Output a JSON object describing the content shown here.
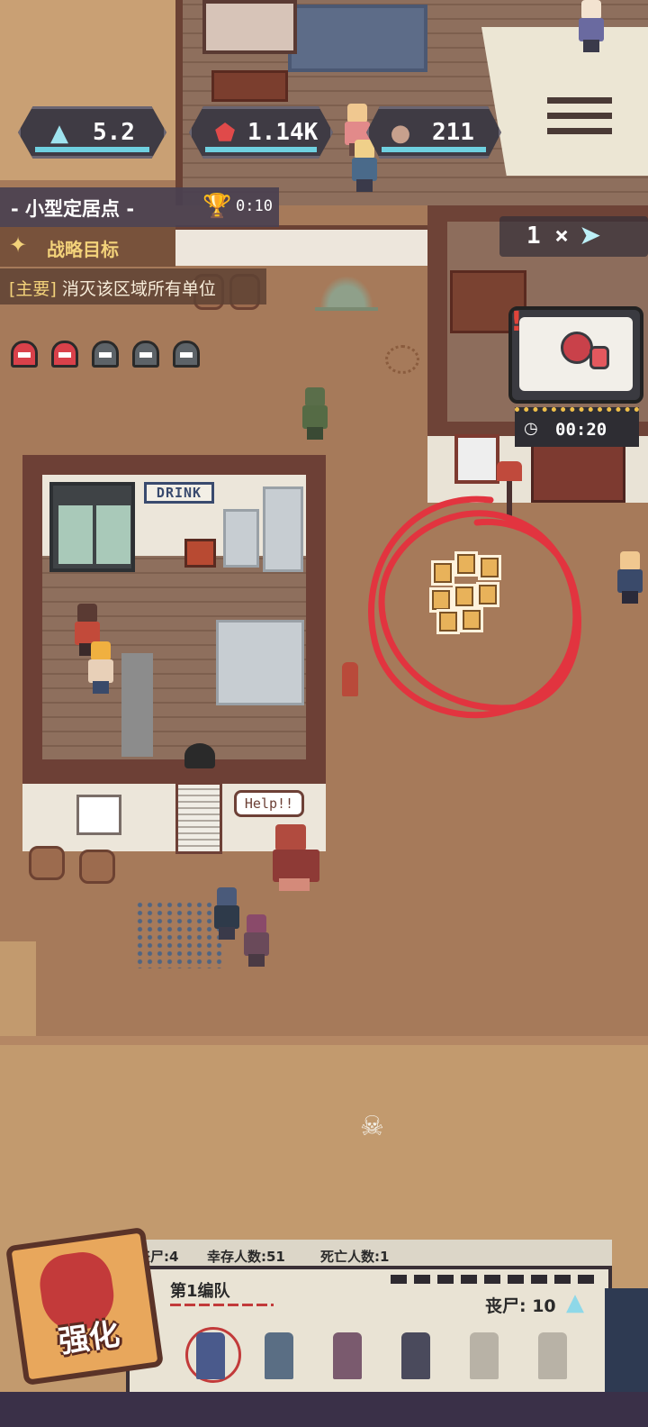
{
  "hud": {
    "resources": {
      "crystal": {
        "value": "5.2",
        "icon": "crystal-icon"
      },
      "gear": {
        "value": "1.14K",
        "icon": "gear-icon"
      },
      "stone": {
        "value": "211",
        "icon": "stone-icon"
      }
    },
    "level": {
      "name": "- 小型定居点 -",
      "timer": "0:10",
      "icon": "trophy-icon"
    },
    "objective": {
      "title": "战略目标",
      "tag": "[主要]",
      "text": "消灭该区域所有单位"
    },
    "waves": {
      "total": 5,
      "completed": 2
    },
    "speed": {
      "label": "1 ×",
      "icon": "fast-forward-icon"
    },
    "event": {
      "timer": "00:20",
      "icon": "potion-icon"
    }
  },
  "world": {
    "drink_sign": "DRINK",
    "help_bubble": "Help!!"
  },
  "squad_panel": {
    "stats": {
      "zombies": "丧尸:4",
      "survivors": "幸存人数:51",
      "dead": "死亡人数:1"
    },
    "squad_name": "第1编队",
    "zombie_count": "丧尸: 10",
    "slots": [
      {
        "state": "active",
        "color": "#4a5a8c"
      },
      {
        "state": "filled",
        "color": "#5a6e84"
      },
      {
        "state": "filled",
        "color": "#7a5a6e"
      },
      {
        "state": "filled",
        "color": "#4a4a5c"
      },
      {
        "state": "locked"
      },
      {
        "state": "locked"
      }
    ]
  },
  "upgrade_button": {
    "label": "强化"
  },
  "colors": {
    "accent_red": "#d9414a",
    "hud_bg": "#3f3b44",
    "crystal_blue": "#6fd0e0",
    "objective_gold": "#f3d27a"
  }
}
